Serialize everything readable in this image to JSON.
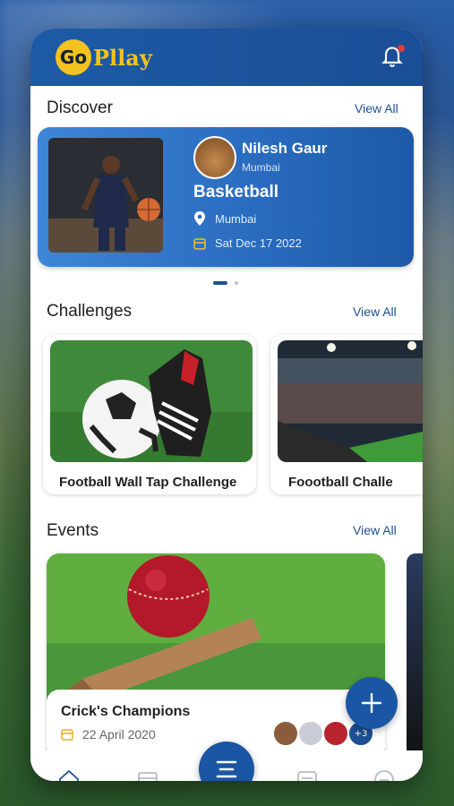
{
  "app": {
    "logo_prefix": "Go",
    "logo_suffix": "Pllay"
  },
  "header": {
    "notification_icon": "bell-icon"
  },
  "discover": {
    "title": "Discover",
    "view_all": "View All",
    "card": {
      "name": "Nilesh Gaur",
      "name_location": "Mumbai",
      "sport": "Basketball",
      "location": "Mumbai",
      "date": "Sat Dec 17 2022"
    }
  },
  "challenges": {
    "title": "Challenges",
    "view_all": "View All",
    "items": [
      {
        "title": "Football Wall Tap Challenge"
      },
      {
        "title": "Foootball Challe"
      }
    ]
  },
  "events": {
    "title": "Events",
    "view_all": "View All",
    "items": [
      {
        "title": "Crick's Champions",
        "date": "22 April 2020",
        "extra_participants": "+3"
      }
    ]
  },
  "colors": {
    "brand_blue": "#1d5aa6",
    "brand_yellow": "#f4c21e"
  },
  "bottom_nav": {
    "items": [
      "home-icon",
      "calendar-icon",
      "menu-icon",
      "list-icon",
      "chat-icon"
    ]
  }
}
